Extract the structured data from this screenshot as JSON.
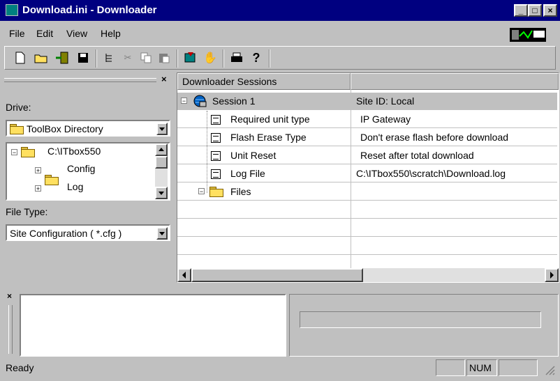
{
  "window": {
    "title": "Download.ini - Downloader",
    "minimize": "_",
    "maximize": "□",
    "close": "×"
  },
  "menu": {
    "file": "File",
    "edit": "Edit",
    "view": "View",
    "help": "Help"
  },
  "toolbar": {
    "icons": [
      "new-icon",
      "open-icon",
      "exit-icon",
      "save-icon",
      "tree-icon",
      "cut-icon",
      "copy-icon",
      "paste-icon",
      "download-icon",
      "stop-icon",
      "print-icon",
      "help-icon"
    ]
  },
  "left": {
    "close_glyph": "×",
    "drive_label": "Drive:",
    "drive_value": "ToolBox Directory",
    "tree": {
      "root": "C:\\ITbox550",
      "items": [
        "Config",
        "Log"
      ]
    },
    "file_type_label": "File Type:",
    "file_type_value": "Site Configuration ( *.cfg )"
  },
  "grid": {
    "header": "Downloader Sessions",
    "session": {
      "name": "Session 1",
      "site": "Site ID:  Local"
    },
    "rows": [
      {
        "key": "Required unit type",
        "value": "IP Gateway"
      },
      {
        "key": "Flash Erase Type",
        "value": "Don't erase flash before download"
      },
      {
        "key": "Unit Reset",
        "value": "Reset after total download"
      },
      {
        "key": "Log File",
        "value": "C:\\ITbox550\\scratch\\Download.log"
      }
    ],
    "files": "Files"
  },
  "bottom": {
    "close_glyph": "×"
  },
  "status": {
    "text": "Ready",
    "num": "NUM"
  },
  "colors": {
    "titlebar": "#000080",
    "selection": "#c0c0c0"
  }
}
